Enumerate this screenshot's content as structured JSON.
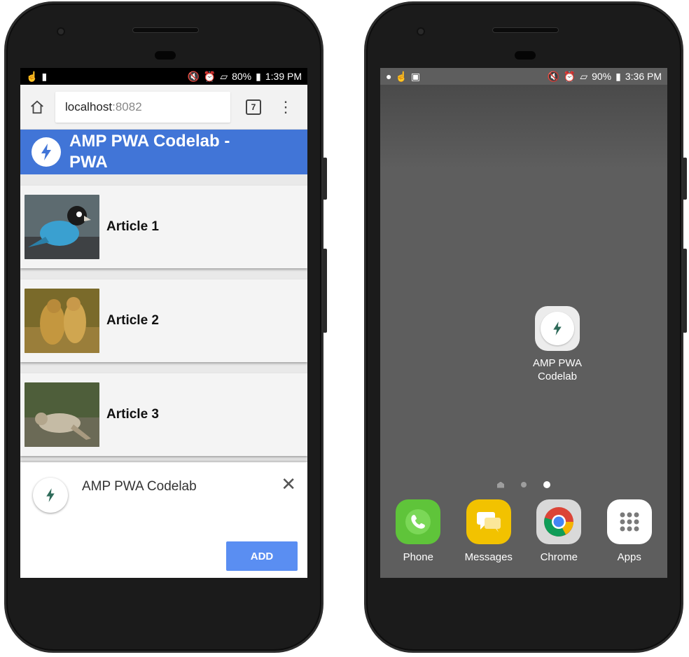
{
  "left_phone": {
    "status": {
      "battery": "80%",
      "time": "1:39 PM"
    },
    "browser": {
      "url_host": "localhost",
      "url_port": ":8082",
      "tab_count": "7"
    },
    "app": {
      "title": "AMP PWA Codelab - PWA"
    },
    "articles": [
      {
        "title": "Article 1"
      },
      {
        "title": "Article 2"
      },
      {
        "title": "Article 3"
      }
    ],
    "install_banner": {
      "title": "AMP PWA Codelab",
      "add_label": "ADD"
    }
  },
  "right_phone": {
    "status": {
      "battery": "90%",
      "time": "3:36 PM"
    },
    "shortcut": {
      "label_line1": "AMP PWA",
      "label_line2": "Codelab"
    },
    "dock": [
      {
        "label": "Phone",
        "icon": "phone-icon"
      },
      {
        "label": "Messages",
        "icon": "messages-icon"
      },
      {
        "label": "Chrome",
        "icon": "chrome-icon"
      },
      {
        "label": "Apps",
        "icon": "apps-grid-icon"
      }
    ]
  },
  "colors": {
    "header_blue": "#4175d7",
    "add_button": "#5a8ef2",
    "amp_green": "#2f6b5a"
  }
}
